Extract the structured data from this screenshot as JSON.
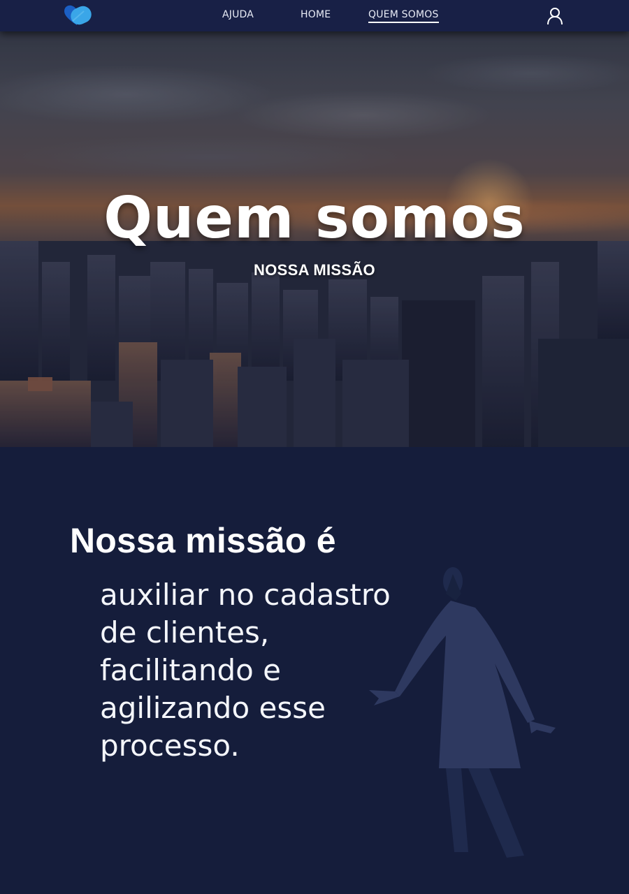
{
  "nav": {
    "logo_icon": "heart-pill-logo-icon",
    "links": [
      "AJUDA",
      "HOME",
      "QUEM SOMOS"
    ],
    "active_link": "QUEM SOMOS",
    "user_icon": "user-icon"
  },
  "hero": {
    "title": "Quem somos",
    "subtitle": "NOSSA MISSÃO"
  },
  "mission": {
    "heading": "Nossa missão é",
    "text": "auxiliar no cadastro de clientes, facilitando e agilizando esse processo."
  },
  "colors": {
    "navbar": "#182046",
    "background": "#151d3b",
    "logo_dark": "#1b5fc4",
    "logo_light": "#3aa6e8",
    "figure": "#2e3960"
  }
}
